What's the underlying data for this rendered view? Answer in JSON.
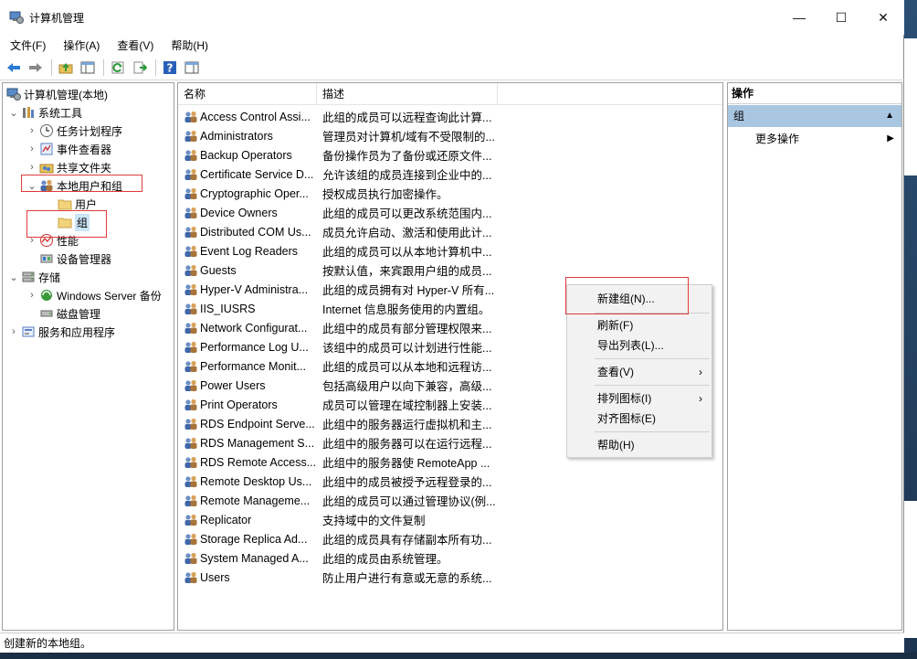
{
  "window": {
    "title": "计算机管理",
    "minimize_glyph": "—",
    "maximize_glyph": "☐",
    "close_glyph": "✕"
  },
  "menubar": [
    "文件(F)",
    "操作(A)",
    "查看(V)",
    "帮助(H)"
  ],
  "toolbar": {
    "icons": [
      "back-arrow-icon",
      "forward-arrow-icon",
      "up-folder-icon",
      "show-hide-tree-icon",
      "refresh-icon",
      "export-list-icon",
      "help-icon",
      "action-pane-icon"
    ]
  },
  "tree": {
    "root": "计算机管理(本地)",
    "items": [
      {
        "label": "系统工具",
        "level": 1,
        "expander": "⌄",
        "icon": "tools-icon"
      },
      {
        "label": "任务计划程序",
        "level": 2,
        "expander": "›",
        "icon": "clock-icon"
      },
      {
        "label": "事件查看器",
        "level": 2,
        "expander": "›",
        "icon": "event-viewer-icon"
      },
      {
        "label": "共享文件夹",
        "level": 2,
        "expander": "›",
        "icon": "shared-folder-icon"
      },
      {
        "label": "本地用户和组",
        "level": 2,
        "expander": "⌄",
        "icon": "users-groups-icon"
      },
      {
        "label": "用户",
        "level": 3,
        "expander": "",
        "icon": "folder-icon"
      },
      {
        "label": "组",
        "level": 3,
        "expander": "",
        "icon": "folder-icon",
        "selected": true
      },
      {
        "label": "性能",
        "level": 2,
        "expander": "›",
        "icon": "performance-icon"
      },
      {
        "label": "设备管理器",
        "level": 2,
        "expander": "",
        "icon": "device-manager-icon"
      },
      {
        "label": "存储",
        "level": 1,
        "expander": "⌄",
        "icon": "storage-icon"
      },
      {
        "label": "Windows Server 备份",
        "level": 2,
        "expander": "›",
        "icon": "backup-icon"
      },
      {
        "label": "磁盘管理",
        "level": 2,
        "expander": "",
        "icon": "disk-icon"
      },
      {
        "label": "服务和应用程序",
        "level": 1,
        "expander": "›",
        "icon": "services-icon"
      }
    ]
  },
  "list": {
    "columns": [
      "名称",
      "描述"
    ],
    "rows": [
      {
        "name": "Access Control Assi...",
        "desc": "此组的成员可以远程查询此计算..."
      },
      {
        "name": "Administrators",
        "desc": "管理员对计算机/域有不受限制的..."
      },
      {
        "name": "Backup Operators",
        "desc": "备份操作员为了备份或还原文件..."
      },
      {
        "name": "Certificate Service D...",
        "desc": "允许该组的成员连接到企业中的..."
      },
      {
        "name": "Cryptographic Oper...",
        "desc": "授权成员执行加密操作。"
      },
      {
        "name": "Device Owners",
        "desc": "此组的成员可以更改系统范围内..."
      },
      {
        "name": "Distributed COM Us...",
        "desc": "成员允许启动、激活和使用此计..."
      },
      {
        "name": "Event Log Readers",
        "desc": "此组的成员可以从本地计算机中..."
      },
      {
        "name": "Guests",
        "desc": "按默认值，来宾跟用户组的成员..."
      },
      {
        "name": "Hyper-V Administra...",
        "desc": "此组的成员拥有对 Hyper-V 所有..."
      },
      {
        "name": "IIS_IUSRS",
        "desc": "Internet 信息服务使用的内置组。"
      },
      {
        "name": "Network Configurat...",
        "desc": "此组中的成员有部分管理权限来..."
      },
      {
        "name": "Performance Log U...",
        "desc": "该组中的成员可以计划进行性能..."
      },
      {
        "name": "Performance Monit...",
        "desc": "此组的成员可以从本地和远程访..."
      },
      {
        "name": "Power Users",
        "desc": "包括高级用户以向下兼容，高级..."
      },
      {
        "name": "Print Operators",
        "desc": "成员可以管理在域控制器上安装..."
      },
      {
        "name": "RDS Endpoint Serve...",
        "desc": "此组中的服务器运行虚拟机和主..."
      },
      {
        "name": "RDS Management S...",
        "desc": "此组中的服务器可以在运行远程..."
      },
      {
        "name": "RDS Remote Access...",
        "desc": "此组中的服务器使 RemoteApp ..."
      },
      {
        "name": "Remote Desktop Us...",
        "desc": "此组中的成员被授予远程登录的..."
      },
      {
        "name": "Remote Manageme...",
        "desc": "此组的成员可以通过管理协议(例..."
      },
      {
        "name": "Replicator",
        "desc": "支持域中的文件复制"
      },
      {
        "name": "Storage Replica Ad...",
        "desc": "此组的成员具有存储副本所有功..."
      },
      {
        "name": "System Managed A...",
        "desc": "此组的成员由系统管理。"
      },
      {
        "name": "Users",
        "desc": "防止用户进行有意或无意的系统..."
      }
    ]
  },
  "context_menu": {
    "items": [
      {
        "label": "新建组(N)...",
        "submenu": false
      },
      {
        "label": "刷新(F)",
        "submenu": false
      },
      {
        "label": "导出列表(L)...",
        "submenu": false
      },
      {
        "label": "查看(V)",
        "submenu": true
      },
      {
        "label": "排列图标(I)",
        "submenu": true
      },
      {
        "label": "对齐图标(E)",
        "submenu": false
      },
      {
        "label": "帮助(H)",
        "submenu": false
      }
    ],
    "submenu_glyph": "›"
  },
  "actions": {
    "header": "操作",
    "group": "组",
    "group_glyph": "▲",
    "more": "更多操作",
    "more_glyph": "▶"
  },
  "status": "创建新的本地组。",
  "colors": {
    "highlight_box": "#e23a3a",
    "selection": "#cce4f7",
    "action_group": "#a9c6e1"
  }
}
